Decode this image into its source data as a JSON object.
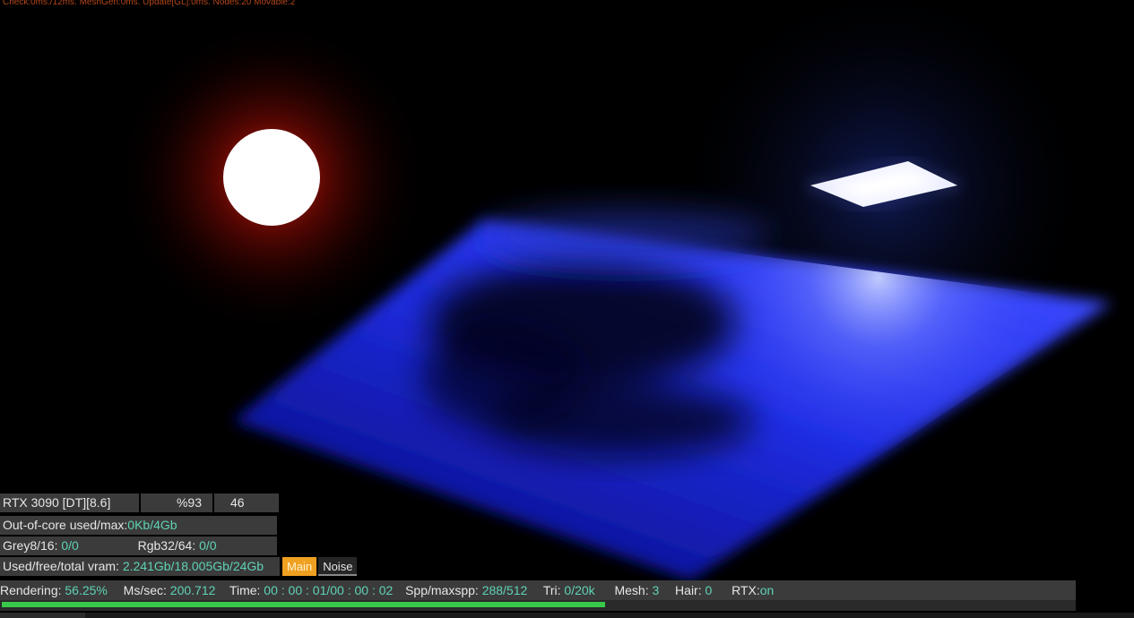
{
  "debug": {
    "text": "Check:0ms./12ms. MeshGen:0ms. Update[GL]:0ms. Nodes:20 Movable:2"
  },
  "gpu_row": {
    "device": "RTX 3090 [DT][8.6]",
    "percent": "%93",
    "temp": "46"
  },
  "out_of_core": {
    "label": "Out-of-core used/max:",
    "value": "0Kb/4Gb"
  },
  "textures": {
    "grey_label": "Grey8/16: ",
    "grey_value": "0/0",
    "rgb_label": "Rgb32/64: ",
    "rgb_value": "0/0"
  },
  "vram": {
    "label": "Used/free/total vram: ",
    "value": "2.241Gb/18.005Gb/24Gb"
  },
  "tabs": {
    "main": "Main",
    "noise": "Noise"
  },
  "status": {
    "rendering_label": "Rendering: ",
    "rendering_value": "56.25%",
    "ms_label": "Ms/sec: ",
    "ms_value": "200.712",
    "time_label": "Time: ",
    "time_value": "00 : 00 : 01/00 : 00 : 02",
    "spp_label": "Spp/maxspp: ",
    "spp_value": "288/512",
    "tri_label": "Tri: ",
    "tri_value": "0/20k",
    "mesh_label": "Mesh: ",
    "mesh_value": "3",
    "hair_label": "Hair: ",
    "hair_value": "0",
    "rtx_label": "RTX:",
    "rtx_value": "on"
  },
  "progress": {
    "fraction": 0.5625
  },
  "colors": {
    "value_teal": "#5fd3b6",
    "progress_green": "#38c94a",
    "tab_active": "#f0a020",
    "sphere_glow": "#ff2a10",
    "plane_blue": "#1a2cff"
  }
}
